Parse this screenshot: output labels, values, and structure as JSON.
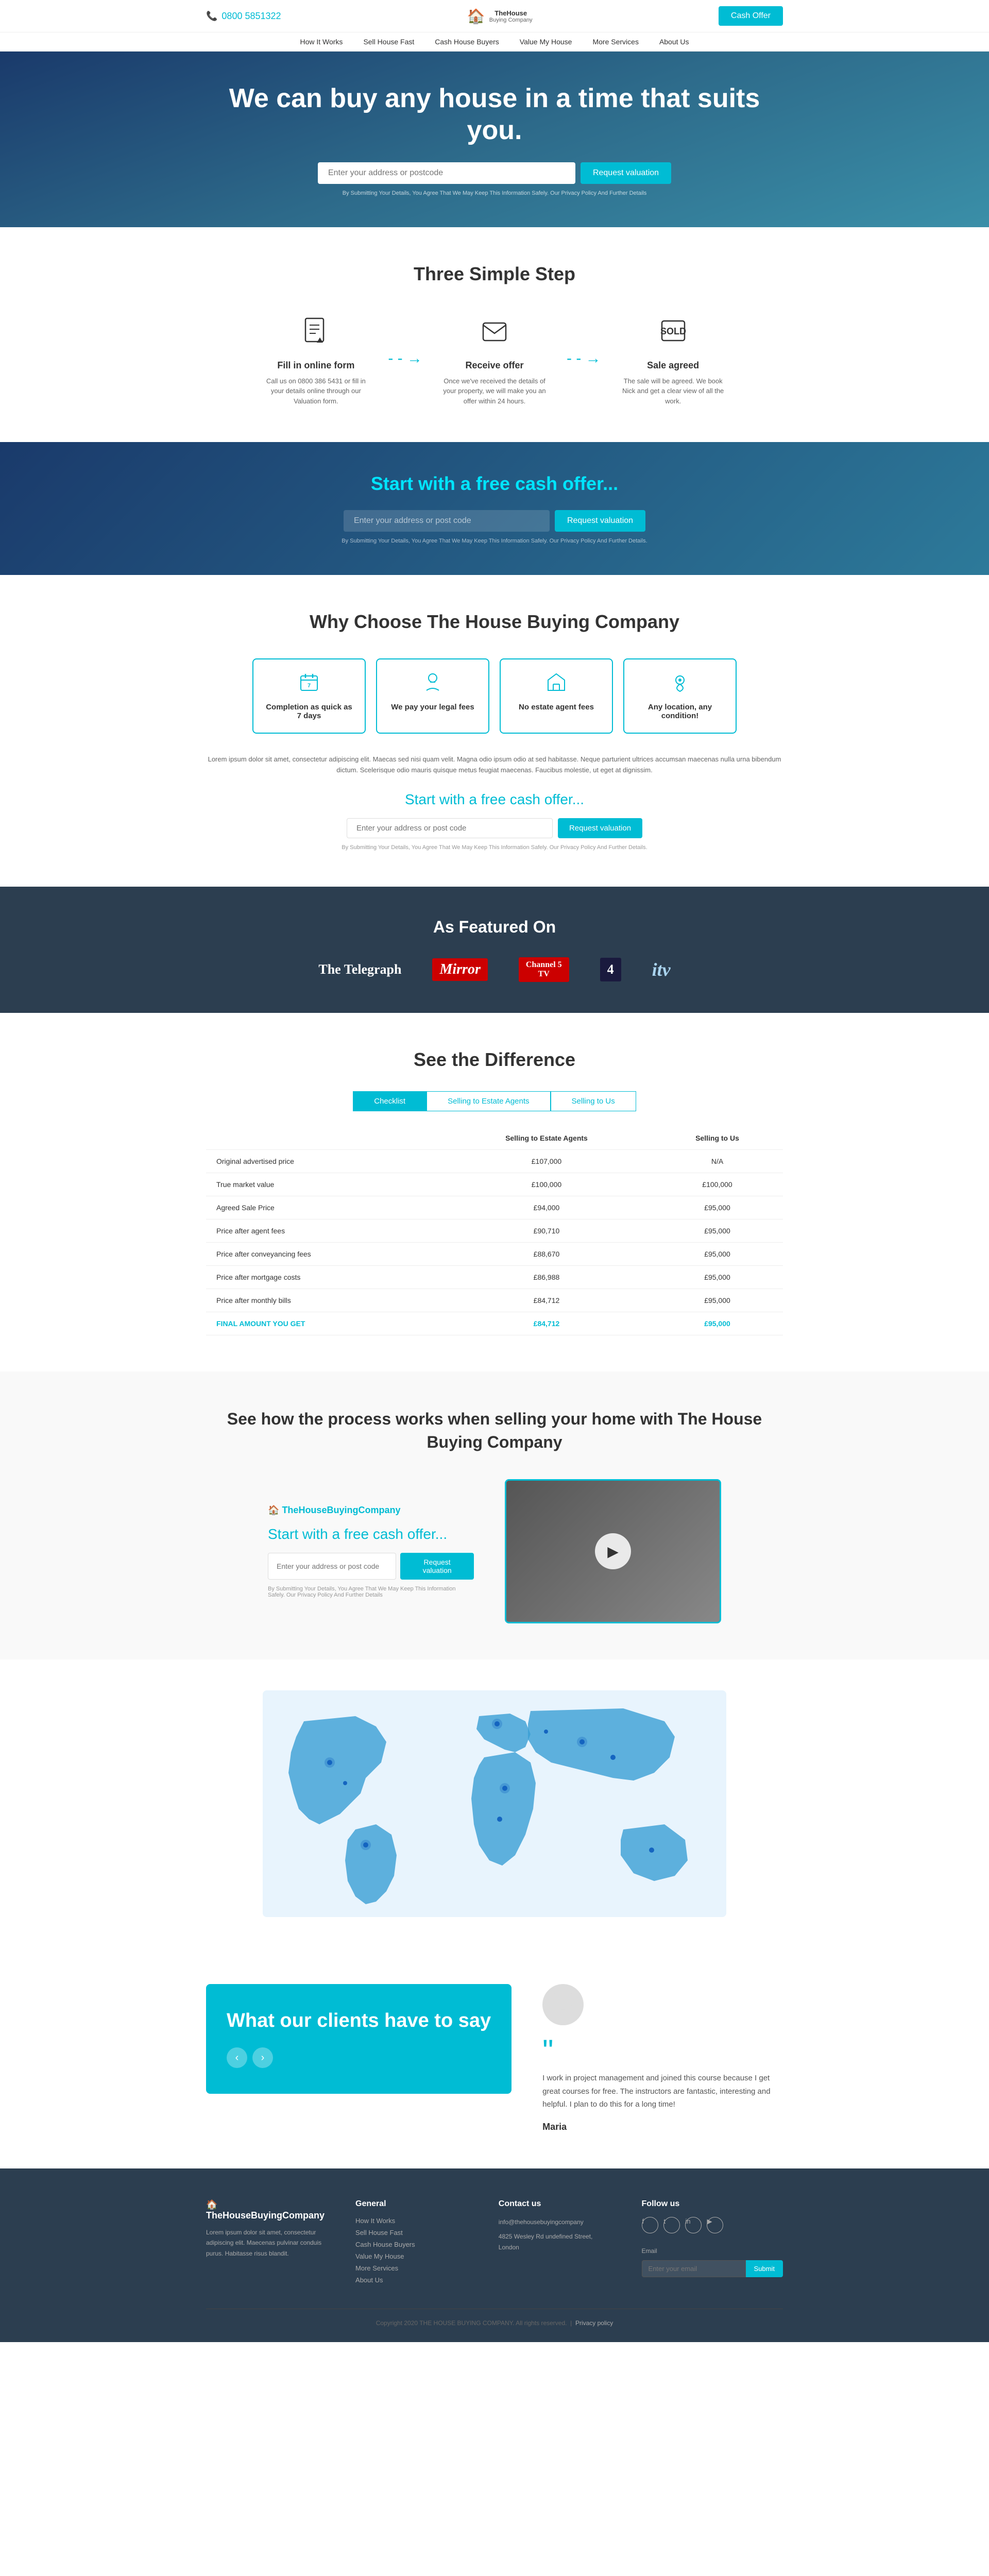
{
  "header": {
    "phone": "0800 5851322",
    "logo_line1": "TheHouse",
    "logo_line2": "Buying Company",
    "cash_offer_btn": "Cash Offer"
  },
  "nav": {
    "items": [
      "How It Works",
      "Sell House Fast",
      "Cash House Buyers",
      "Value My House",
      "More Services",
      "About Us"
    ]
  },
  "hero": {
    "headline": "We can buy any house in a time that suits you.",
    "input_placeholder": "Enter your address or postcode",
    "btn_label": "Request valuation",
    "disclaimer": "By Submitting Your Details, You Agree That We May Keep This Information Safely. Our Privacy Policy And Further Details"
  },
  "three_steps": {
    "heading": "Three Simple Step",
    "steps": [
      {
        "icon": "📋",
        "title": "Fill in online form",
        "desc": "Call us on 0800 386 5431 or fill in your details online through our Valuation form."
      },
      {
        "icon": "📨",
        "title": "Receive offer",
        "desc": "Once we've received the details of your property, we will make you an offer within 24 hours."
      },
      {
        "icon": "🏷️",
        "title": "Sale agreed",
        "desc": "The sale will be agreed. We book Nick and get a clear view of all the work."
      }
    ]
  },
  "cash_offer_section": {
    "heading": "Start with a free cash offer...",
    "input_placeholder": "Enter your address or post code",
    "btn_label": "Request valuation",
    "disclaimer": "By Submitting Your Details, You Agree That We May Keep This Information Safely. Our Privacy Policy And Further Details."
  },
  "why_choose": {
    "heading": "Why Choose The House Buying Company",
    "features": [
      {
        "icon": "📅",
        "title": "Completion as quick as 7 days"
      },
      {
        "icon": "⚖️",
        "title": "We pay your legal fees"
      },
      {
        "icon": "🏠",
        "title": "No estate agent fees"
      },
      {
        "icon": "📍",
        "title": "Any location, any condition!"
      }
    ],
    "lorem": "Lorem ipsum dolor sit amet, consectetur adipiscing elit. Maecas sed nisi quam velit. Magna odio ipsum odio at sed habitasse. Neque parturient ultrices accumsan maecenas nulla urna bibendum dictum. Scelerisque odio mauris quisque metus feugiat maecenas. Faucibus molestie, ut eget at dignissim.",
    "form_title": "Start with a free cash offer...",
    "input_placeholder": "Enter your address or post code",
    "btn_label": "Request valuation",
    "disclaimer": "By Submitting Your Details, You Agree That We May Keep This Information Safely. Our Privacy Policy And Further Details."
  },
  "featured_on": {
    "heading": "As Featured On",
    "logos": [
      "The Telegraph",
      "Mirror",
      "Channel 5 TV",
      "4",
      "itv"
    ]
  },
  "difference": {
    "heading": "See the Difference",
    "tabs": [
      "Checklist",
      "Selling to Estate Agents",
      "Selling to Us"
    ],
    "table_headers": [
      "",
      "Selling to Estate Agents",
      "Selling to Us"
    ],
    "rows": [
      {
        "label": "Original advertised price",
        "estate": "£107,000",
        "us": "N/A"
      },
      {
        "label": "True market value",
        "estate": "£100,000",
        "us": "£100,000"
      },
      {
        "label": "Agreed Sale Price",
        "estate": "£94,000",
        "us": "£95,000"
      },
      {
        "label": "Price after agent fees",
        "estate": "£90,710",
        "us": "£95,000"
      },
      {
        "label": "Price after conveyancing fees",
        "estate": "£88,670",
        "us": "£95,000"
      },
      {
        "label": "Price after mortgage costs",
        "estate": "£86,988",
        "us": "£95,000"
      },
      {
        "label": "Price after monthly bills",
        "estate": "£84,712",
        "us": "£95,000"
      },
      {
        "label": "FINAL AMOUNT YOU GET",
        "estate": "£84,712",
        "us": "£95,000",
        "final": true
      }
    ]
  },
  "video_section": {
    "heading": "See how the process works when selling your home with The House Buying Company",
    "logo": "TheHouseBuyingCompany",
    "form_title": "Start with a free cash offer...",
    "input_placeholder": "Enter your address or post code",
    "btn_label": "Request valuation",
    "disclaimer": "By Submitting Your Details, You Agree That We May Keep This Information Safely. Our Privacy Policy And Further Details"
  },
  "testimonials": {
    "heading": "What our clients have to say",
    "quote": "I work in project management and joined this course because I get great courses for free. The instructors are fantastic, interesting and helpful. I plan to do this for a long time!",
    "reviewer_name": "Maria",
    "nav_prev": "‹",
    "nav_next": "›"
  },
  "footer": {
    "logo": "TheHouseBuyingCompany",
    "about_text": "Lorem ipsum dolor sit amet, consectetur adipiscing elit. Maecenas pulvinar conduis purus. Habitasse risus blandit.",
    "general_heading": "General",
    "general_links": [
      "How It Works",
      "Sell House Fast",
      "Cash House Buyers",
      "Value My House",
      "More Services",
      "About Us"
    ],
    "contact_heading": "Contact us",
    "contact_email": "info@thehousebuyingcompany",
    "contact_address": "4825 Wesley Rd undefined Street, London",
    "follow_heading": "Follow us",
    "social": [
      "f",
      "t",
      "in",
      "yt"
    ],
    "email_label": "Email",
    "email_placeholder": "Enter your email",
    "email_btn": "Submit",
    "copyright": "Copyright 2020 THE HOUSE BUYING COMPANY. All rights reserved.",
    "privacy_link": "Privacy policy"
  }
}
